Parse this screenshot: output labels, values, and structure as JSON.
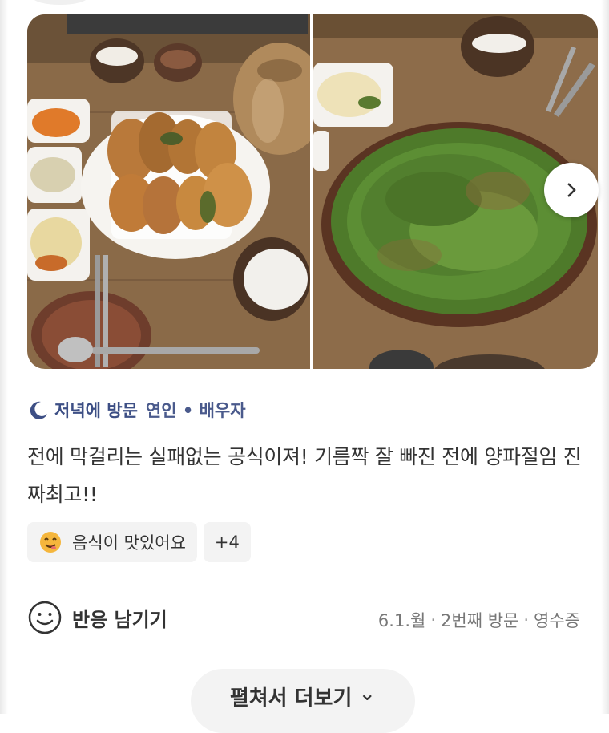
{
  "gallery": {
    "photos": [
      {
        "icon": "food-photo-jeon-platter-icon"
      },
      {
        "icon": "food-photo-pajeon-icon"
      }
    ],
    "next_icon": "chevron-right-icon"
  },
  "visit": {
    "icon": "moon-icon",
    "time_label": "저녁에 방문",
    "with_label": "연인 • 배우자"
  },
  "review": {
    "text": "전에 막걸리는 실패없는 공식이져! 기름짝 잘 빠진 전에 양파절임 진짜최고!!"
  },
  "tags": {
    "items": [
      {
        "emoji": "yum-face-icon",
        "label": "음식이 맛있어요"
      },
      {
        "label": "+4"
      }
    ]
  },
  "footer": {
    "react_label": "반응 남기기",
    "react_icon": "smile-icon",
    "visit_date": "6.1.월",
    "visit_count": "2번째 방문",
    "verification": "영수증",
    "separator": "·"
  },
  "more_button": {
    "label": "펼쳐서 더보기",
    "icon": "chevron-down-icon"
  },
  "colors": {
    "visit_accent": "#3d4f85",
    "tag_bg": "#f3f3f3",
    "text": "#333333",
    "meta": "#777777"
  }
}
